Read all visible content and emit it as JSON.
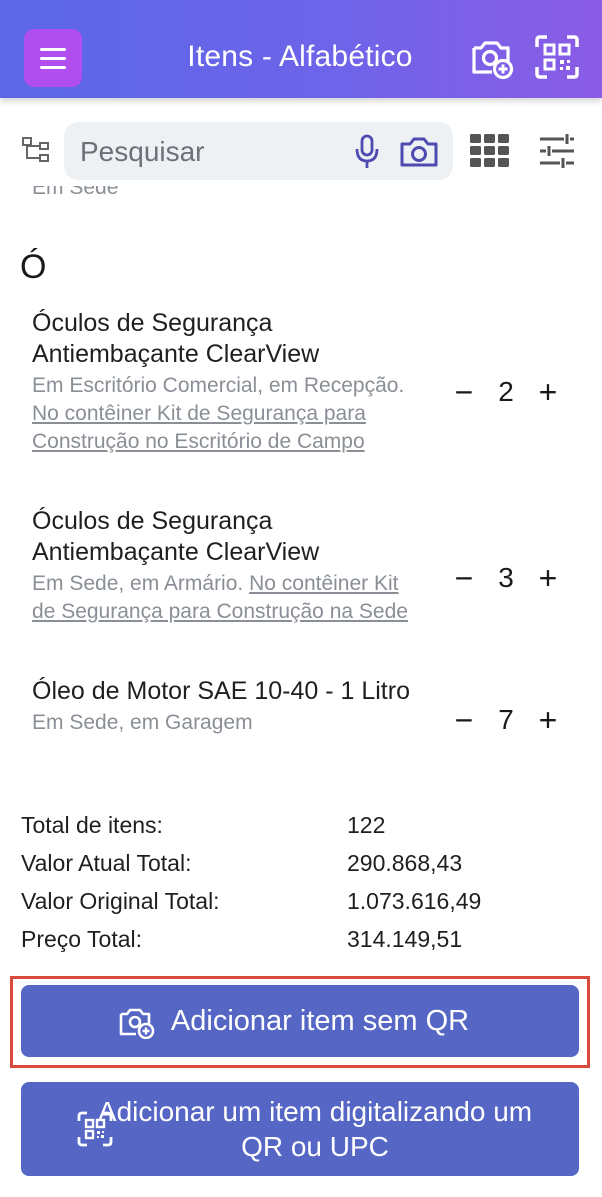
{
  "header": {
    "title": "Itens - Alfabético",
    "menu_icon": "hamburger-menu-icon",
    "add_photo_icon": "camera-plus-icon",
    "scan_icon": "qr-scan-icon"
  },
  "search": {
    "placeholder": "Pesquisar",
    "tree_icon": "hierarchy-tree-icon",
    "mic_icon": "microphone-icon",
    "camera_icon": "camera-icon",
    "grid_icon": "grid-view-icon",
    "filter_icon": "sliders-filter-icon"
  },
  "list": {
    "partial_text": "Em Sede",
    "section_letter": "Ó",
    "items": [
      {
        "name": "Óculos de Segurança Antiembaçante ClearView",
        "location": "Em Escritório Comercial, em Recepção.",
        "container": "No contêiner Kit de Segurança para Construção no Escritório de Campo",
        "quantity": "2",
        "minus": "−",
        "plus": "+"
      },
      {
        "name": "Óculos de Segurança Antiembaçante ClearView",
        "location": "Em Sede, em Armário.",
        "container": "No contêiner Kit de Segurança para Construção na Sede",
        "quantity": "3",
        "minus": "−",
        "plus": "+"
      },
      {
        "name": "Óleo de Motor SAE 10-40 - 1 Litro",
        "location": "Em Sede, em Garagem",
        "container": "",
        "quantity": "7",
        "minus": "−",
        "plus": "+"
      }
    ]
  },
  "totals": {
    "rows": [
      {
        "label": "Total de itens:",
        "value": "122"
      },
      {
        "label": "Valor Atual Total:",
        "value": "290.868,43"
      },
      {
        "label": "Valor Original Total:",
        "value": "1.073.616,49"
      },
      {
        "label": "Preço Total:",
        "value": "314.149,51"
      }
    ]
  },
  "actions": {
    "add_without_qr": "Adicionar item sem QR",
    "add_by_scan": "Adicionar um item digitalizando um QR ou UPC"
  },
  "colors": {
    "header_start": "#5b67e8",
    "header_end": "#8b5ce6",
    "menu_button": "#b04ef0",
    "primary_button": "#5566c4",
    "highlight_border": "#d9493c"
  }
}
